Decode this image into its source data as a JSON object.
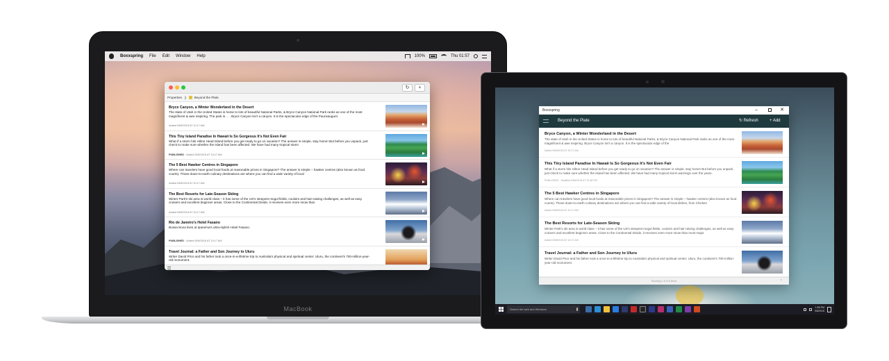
{
  "mac": {
    "menubar": {
      "app_name": "Boxxspring",
      "menus": [
        "File",
        "Edit",
        "Window",
        "Help"
      ],
      "battery": "100%",
      "clock": "Thu 01:57"
    },
    "toolbar": {
      "refresh_symbol": "↻",
      "add_symbol": "+"
    },
    "breadcrumb": {
      "root": "Properties",
      "separator": "❯",
      "current": "Beyond the Plate"
    },
    "items": [
      {
        "title": "Bryce Canyon, a Winter Wonderland in the Desert",
        "desc": "The state of Utah in the United States is home to lots of beautiful National Parks, & Bryce Canyon National Park ranks as one of the most magnificent & awe inspiring. The park is . . . Bryce Canyon isn't a canyon. It is the spectacular edge of the Paunsaugunt",
        "status": "",
        "added": "Added 09/8/2015 AT 10:17 AM",
        "thumb": "canyon"
      },
      {
        "title": "This Tiny Island Paradise In Hawaii Is So Gorgeous It's Not Even Fair",
        "desc": "What if a storm hits Hilton Head Island before you get ready to go on vacation? The answer is simple, stay home! But before you unpack, just check to make sure whether the island has been affected. We have had many tropical storm",
        "status": "PUBLISHED",
        "added": "Added 09/8/2015 AT 10:17 AM",
        "thumb": "hawaii"
      },
      {
        "title": "The 5 Best Hawker Centres in Singapore",
        "desc": "Where can travelers have good local foods at reasonable prices in Singapore? The answer is simple – hawker centres (also known as food courts). Those down-to-earth culinary destinations are where you can find a wide variety of local",
        "status": "",
        "added": "Added 09/8/2015 AT 10:17 AM",
        "thumb": "hawker"
      },
      {
        "title": "The Best Resorts for Late-Season Skiing",
        "desc": "Winter Park's ski area is world class – it has some of the US's steepest mogul fields, couloirs and hair-raising challenges, as well as easy cruisers and excellent beginner areas. Close to the Continental Divide, it receives even more snow than",
        "status": "",
        "added": "Added 09/8/2015 AT 10:17 AM",
        "thumb": "ski"
      },
      {
        "title": "Rio de Janeiro's Hotel Fasano",
        "desc": "Bossa Nova lives at Ipanema's ultra-stylish Hotel Fasano.",
        "status": "PUBLISHED",
        "added": "Added 09/8/2015 AT 10:17 AM",
        "thumb": "rio"
      },
      {
        "title": "Travel Journal: a Father and Son Journey to Uluru",
        "desc": "Writer David Prior and his father took a once-in-a-lifetime trip to Australia's physical and spiritual center: Uluru, the continent's 700-million-year-old monument.",
        "status": "",
        "added": "",
        "thumb": "uluru"
      }
    ],
    "device_brand": "MacBook"
  },
  "win": {
    "window_title": "Boxxspring",
    "controls": {
      "min": "–",
      "close": "✕"
    },
    "header": {
      "title": "Beyond the Plate",
      "refresh_label": "↻ Refresh",
      "add_label": "+ Add"
    },
    "items": [
      {
        "title": "Bryce Canyon, a Winter Wonderland in the Desert",
        "desc": "The state of Utah in the United States is home to lots of beautiful National Parks, & Bryce Canyon National Park ranks as one of the most magnificent & awe inspiring. Bryce Canyon isn't a canyon. It is the spectacular edge of the",
        "meta": "Added 09/8/2015 AT 10:17 AM",
        "thumb": "canyon"
      },
      {
        "title": "This Tiny Island Paradise In Hawaii Is So Gorgeous It's Not Even Fair",
        "desc": "What if a storm hits Hilton Head Island before you get ready to go on vacation? The answer is simple, stay home! But before you unpack, just check to make sure whether the island has been affected. We have had many tropical storm warnings over the years.",
        "meta": "PUBLISHED · Modified 09/8/2015 AT 12:48 PM",
        "thumb": "hawaii"
      },
      {
        "title": "The 5 Best Hawker Centres in Singapore",
        "desc": "Where can travelers have good local foods at reasonable prices in Singapore? The answer is simple – hawker centres (also known as food courts). Those down-to-earth culinary destinations are where you can find a wide variety of local dishes, from Chicken",
        "meta": "Added 09/8/2015 AT 10:17 AM",
        "thumb": "hawker"
      },
      {
        "title": "The Best Resorts for Late-Season Skiing",
        "desc": "Winter Park's ski area is world class – it has some of the US's steepest mogul fields, couloirs and hair-raising challenges, as well as easy cruisers and excellent beginner areas. Close to the Continental Divide, it receives even more snow than most major",
        "meta": "Added 09/8/2015 AT 10:17 AM",
        "thumb": "ski"
      },
      {
        "title": "Travel Journal: a Father and Son Journey to Uluru",
        "desc": "Writer David Prior and his father took a once-in-a-lifetime trip to Australia's physical and spiritual center: Uluru, the continent's 700-million-year-old monument.",
        "meta": "",
        "thumb": "uluru"
      }
    ],
    "footer": {
      "text": "Showing 1-6 of 6 items",
      "chevron": "⌃"
    },
    "taskbar": {
      "search_placeholder": "Search the web and Windows",
      "time": "1:56 PM",
      "date": "9/8/2015"
    }
  }
}
